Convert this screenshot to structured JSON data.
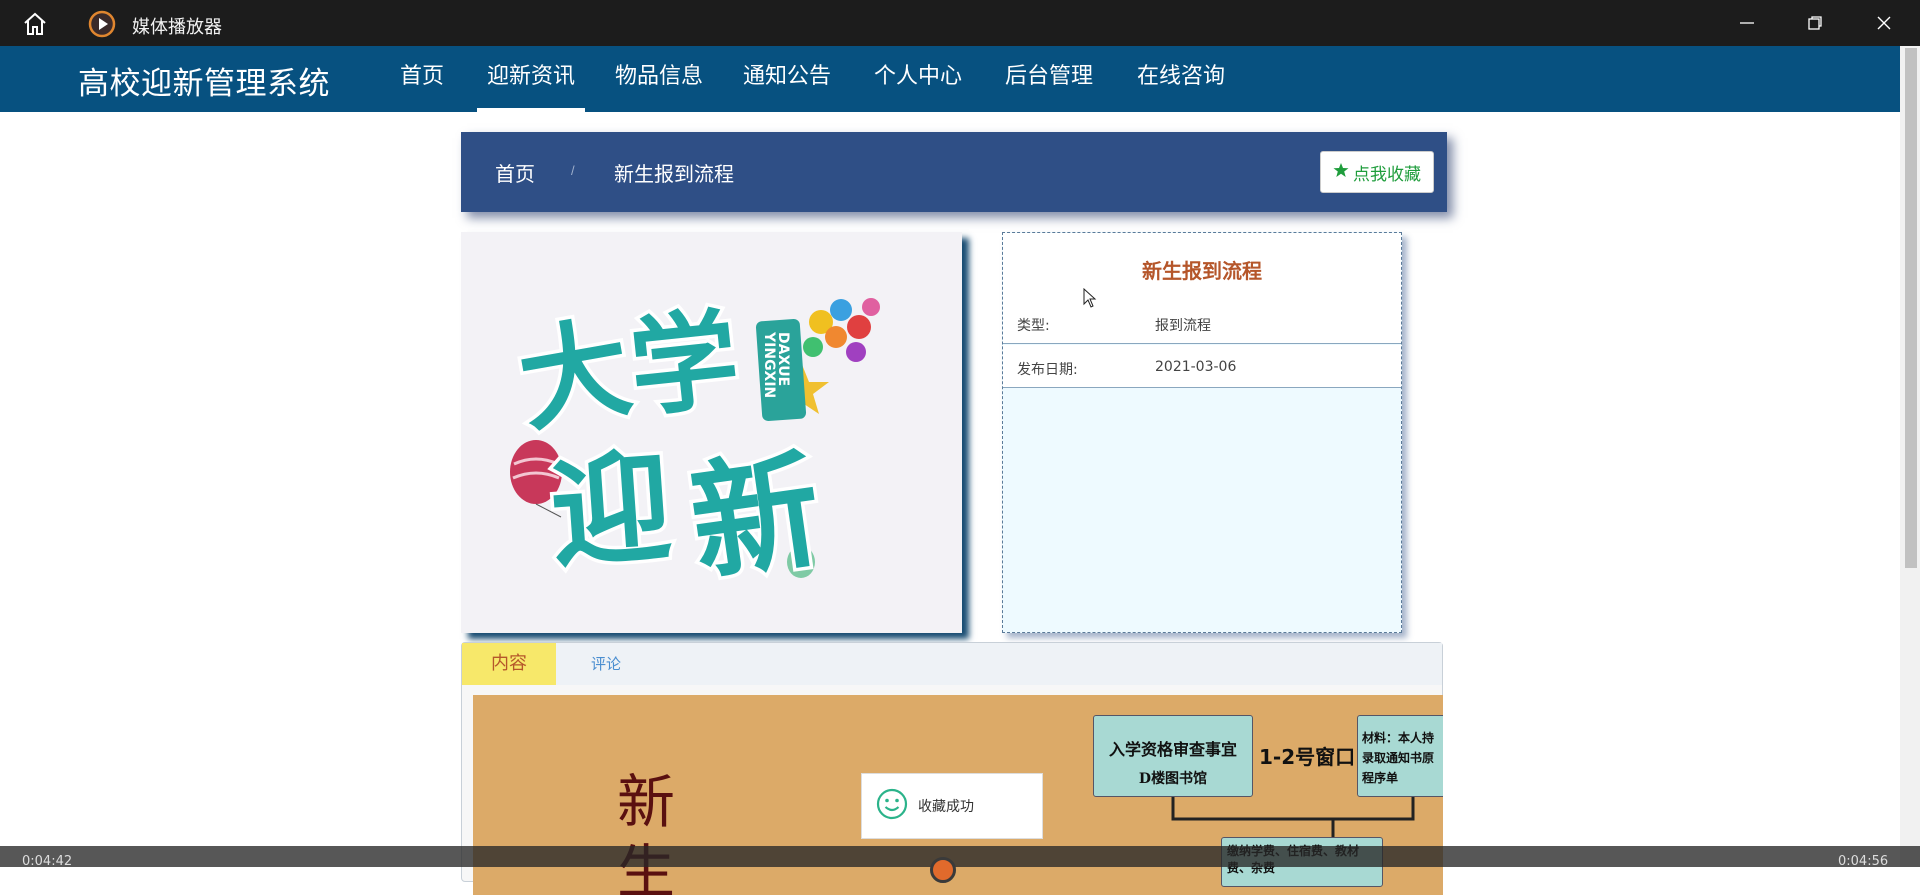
{
  "player": {
    "title": "媒体播放器",
    "time_elapsed": "0:04:42",
    "time_total": "0:04:56",
    "icons": [
      "home-icon",
      "play-icon",
      "minimize-icon",
      "restore-icon",
      "close-icon"
    ]
  },
  "site": {
    "brand": "高校迎新管理系统",
    "nav": [
      {
        "label": "首页"
      },
      {
        "label": "迎新资讯"
      },
      {
        "label": "物品信息"
      },
      {
        "label": "通知公告"
      },
      {
        "label": "个人中心"
      },
      {
        "label": "后台管理"
      },
      {
        "label": "在线咨询"
      }
    ],
    "active_nav": "迎新资讯",
    "colors": {
      "nav_bg": "#075180",
      "crumb_bg": "#2f4f86",
      "title_accent": "#b5562a",
      "fav_green": "#1f9d3c"
    }
  },
  "breadcrumb": {
    "home": "首页",
    "separator": "/",
    "current": "新生报到流程",
    "favorite_label": "点我收藏",
    "favorite_icon": "star-icon"
  },
  "detail": {
    "title": "新生报到流程",
    "rows": [
      {
        "label": "类型:",
        "value": "报到流程"
      },
      {
        "label": "发布日期:",
        "value": "2021-03-06"
      }
    ]
  },
  "tabs": {
    "content": "内容",
    "comments": "评论"
  },
  "poster": {
    "big_chars": [
      "新",
      "生"
    ],
    "box1_line1": "入学资格审查事宜",
    "box1_line2": "D楼图书馆",
    "window_label": "1-2号窗口",
    "box2_lines": [
      "材料：本人持",
      "录取通知书原",
      "程序单"
    ],
    "box3_text": "缴纳学费、住宿费、教材",
    "box3_text2": "费、杂费"
  },
  "toast": {
    "message": "收藏成功",
    "icon": "smile-icon"
  }
}
